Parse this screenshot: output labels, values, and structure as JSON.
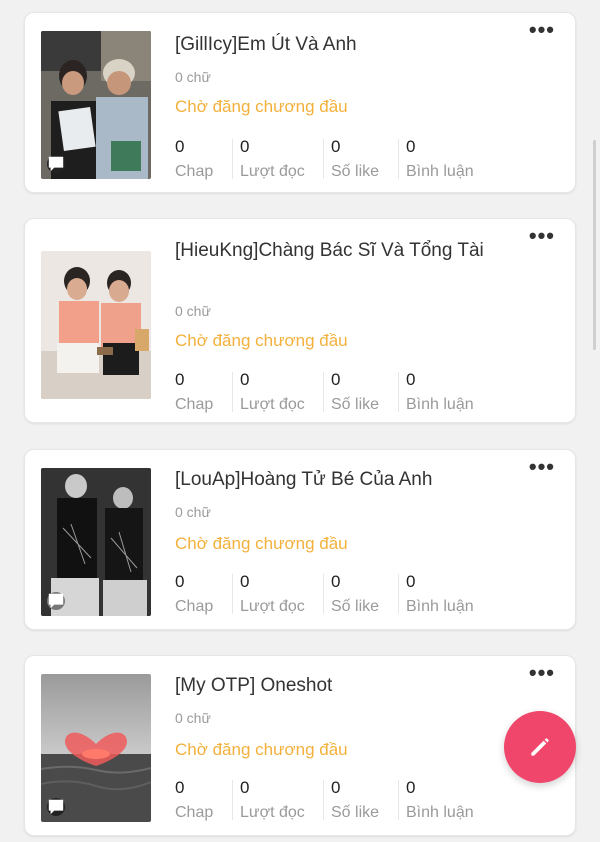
{
  "stories": [
    {
      "title": "[GillIcy]Em Út Và Anh",
      "word_count": "0 chữ",
      "status": "Chờ đăng chương đầu",
      "stats": [
        {
          "value": "0",
          "label": "Chap"
        },
        {
          "value": "0",
          "label": "Lượt đọc"
        },
        {
          "value": "0",
          "label": "Số like"
        },
        {
          "value": "0",
          "label": "Bình luận"
        }
      ],
      "menu_label": "•••"
    },
    {
      "title": "[HieuKng]Chàng Bác Sĩ Và Tổng Tài",
      "word_count": "0 chữ",
      "status": "Chờ đăng chương đầu",
      "stats": [
        {
          "value": "0",
          "label": "Chap"
        },
        {
          "value": "0",
          "label": "Lượt đọc"
        },
        {
          "value": "0",
          "label": "Số like"
        },
        {
          "value": "0",
          "label": "Bình luận"
        }
      ],
      "menu_label": "•••"
    },
    {
      "title": "[LouAp]Hoàng Tử Bé Của Anh",
      "word_count": "0 chữ",
      "status": "Chờ đăng chương đầu",
      "stats": [
        {
          "value": "0",
          "label": "Chap"
        },
        {
          "value": "0",
          "label": "Lượt đọc"
        },
        {
          "value": "0",
          "label": "Số like"
        },
        {
          "value": "0",
          "label": "Bình luận"
        }
      ],
      "menu_label": "•••"
    },
    {
      "title": "[My OTP] Oneshot",
      "word_count": "0 chữ",
      "status": "Chờ đăng chương đầu",
      "stats": [
        {
          "value": "0",
          "label": "Chap"
        },
        {
          "value": "0",
          "label": "Lượt đọc"
        },
        {
          "value": "0",
          "label": "Số like"
        },
        {
          "value": "0",
          "label": "Bình luận"
        }
      ],
      "menu_label": "•••"
    }
  ],
  "colors": {
    "status": "#f3b13c",
    "fab": "#f1466b",
    "muted": "#9a9a9a"
  },
  "icons": {
    "menu": "more-horizontal-icon",
    "fab": "pencil-icon",
    "cover_badge": "comment-icon"
  }
}
